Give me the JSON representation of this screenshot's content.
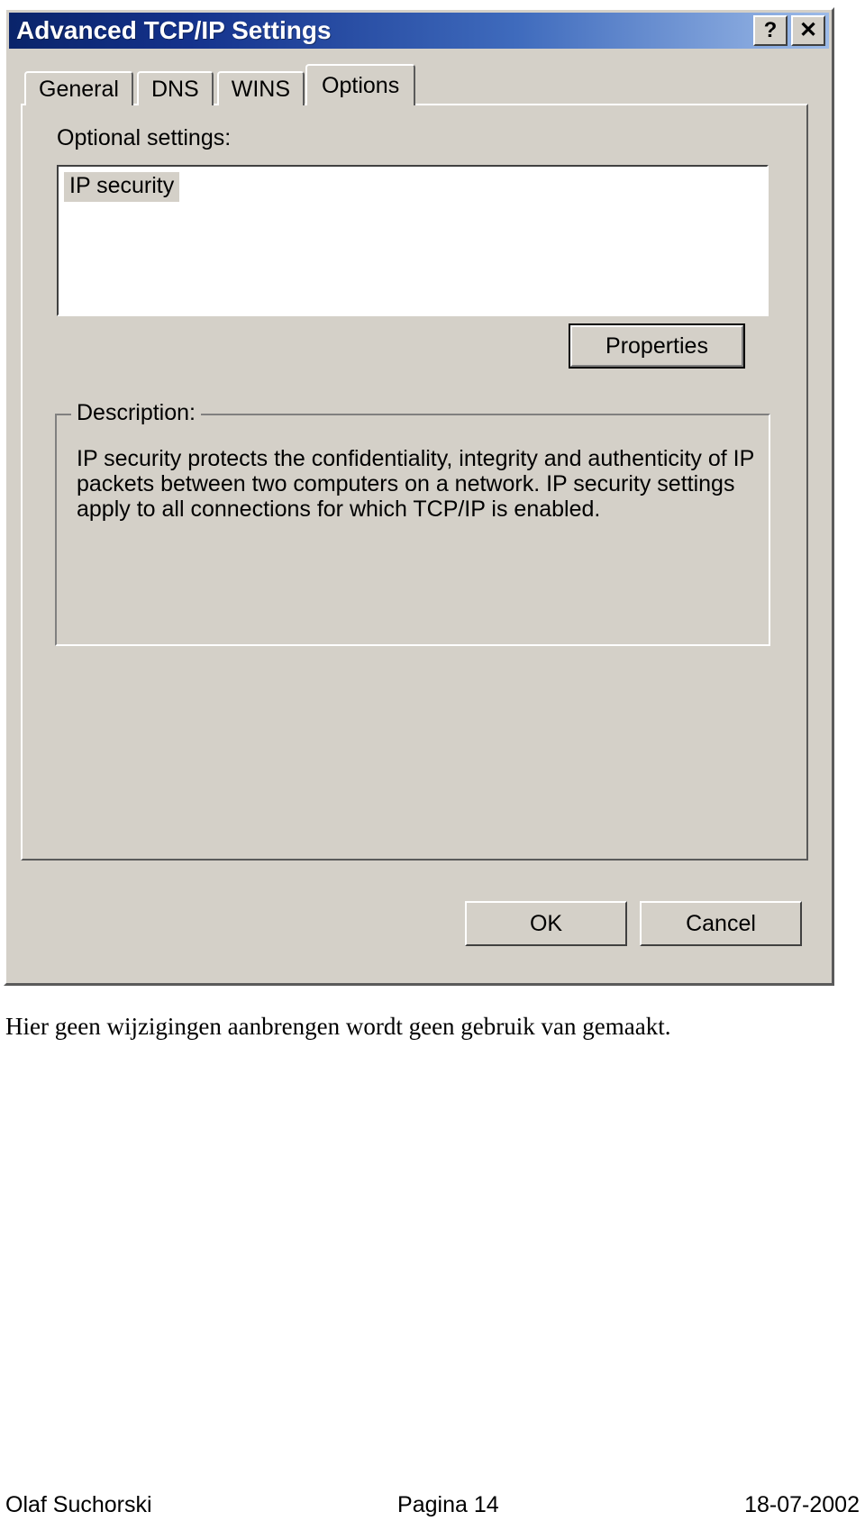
{
  "dialog": {
    "title": "Advanced TCP/IP Settings",
    "caption_buttons": {
      "help": "?",
      "close": "✕"
    },
    "tabs": [
      {
        "label": "General",
        "active": false
      },
      {
        "label": "DNS",
        "active": false
      },
      {
        "label": "WINS",
        "active": false
      },
      {
        "label": "Options",
        "active": true
      }
    ],
    "options_tab": {
      "optional_settings_label": "Optional settings:",
      "optional_settings_items": [
        {
          "label": "IP security",
          "selected": true
        }
      ],
      "properties_button": "Properties",
      "description_legend": "Description:",
      "description_lines": [
        "IP security protects the confidentiality, integrity and authenticity of IP",
        "packets between two computers on a network. IP security settings",
        "apply to all connections for which TCP/IP is enabled."
      ]
    },
    "buttons": {
      "ok": "OK",
      "cancel": "Cancel"
    },
    "colors": {
      "face": "#d4d0c8",
      "titlebar_start": "#0a246a",
      "titlebar_end": "#9dbbe8",
      "selection": "#d4d0c8",
      "text": "#000000"
    }
  },
  "page": {
    "caption": "Hier geen wijzigingen aanbrengen wordt geen gebruik van gemaakt.",
    "footer": {
      "author": "Olaf Suchorski",
      "page": "Pagina 14",
      "date": "18-07-2002"
    }
  }
}
